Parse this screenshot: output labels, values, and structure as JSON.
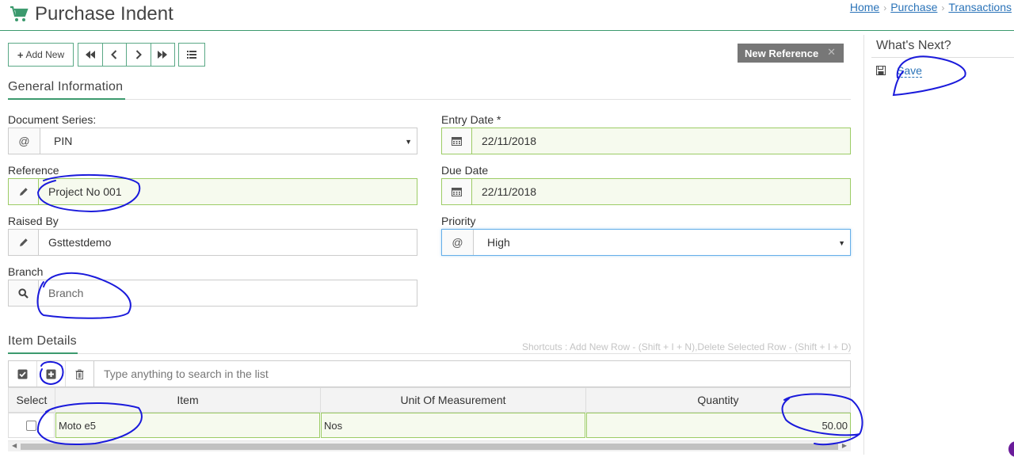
{
  "header": {
    "title": "Purchase Indent",
    "breadcrumb": [
      "Home",
      "Purchase",
      "Transactions"
    ]
  },
  "toolbar": {
    "add_new_label": "Add New",
    "new_reference_label": "New Reference"
  },
  "general": {
    "title": "General Information",
    "document_series": {
      "label": "Document Series:",
      "value": "PIN"
    },
    "entry_date": {
      "label": "Entry Date *",
      "value": "22/11/2018"
    },
    "reference": {
      "label": "Reference",
      "value": "Project No 001"
    },
    "due_date": {
      "label": "Due Date",
      "value": "22/11/2018"
    },
    "raised_by": {
      "label": "Raised By",
      "value": "Gsttestdemo"
    },
    "priority": {
      "label": "Priority",
      "value": "High"
    },
    "branch": {
      "label": "Branch",
      "placeholder": "Branch"
    }
  },
  "items": {
    "title": "Item Details",
    "shortcuts": "Shortcuts : Add New Row - (Shift + I + N),Delete Selected Row - (Shift + I + D)",
    "search_placeholder": "Type anything to search in the list",
    "columns": [
      "Select",
      "Item",
      "Unit Of Measurement",
      "Quantity"
    ],
    "rows": [
      {
        "item": "Moto e5",
        "uom": "Nos",
        "quantity": "50.00"
      }
    ]
  },
  "whats_next": {
    "title": "What's Next?",
    "save_label": "Save"
  },
  "colors": {
    "accent": "#3c9a6e",
    "link": "#2a73b8",
    "field_green": "#f6faee",
    "annotation_ink": "#1a1adb"
  }
}
